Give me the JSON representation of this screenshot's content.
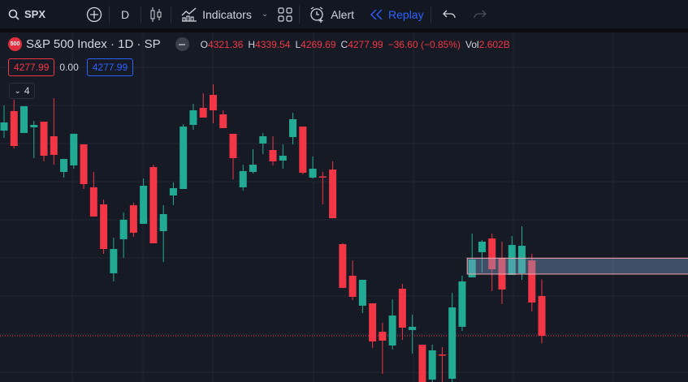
{
  "toolbar": {
    "symbol": "SPX",
    "interval": "D",
    "indicators_label": "Indicators",
    "alert_label": "Alert",
    "replay_label": "Replay"
  },
  "legend": {
    "logo_text": "500",
    "title": "S&P 500 Index · 1D · SP",
    "o_label": "O",
    "o": "4321.36",
    "h_label": "H",
    "h": "4339.54",
    "l_label": "L",
    "l": "4269.69",
    "c_label": "C",
    "c": "4277.99",
    "change": "−36.60 (−0.85%)",
    "vol_label": "Vol",
    "vol": "2.602B"
  },
  "price_boxes": {
    "bid": "4277.99",
    "spread": "0.00",
    "ask": "4277.99"
  },
  "collapse": {
    "count": "4"
  },
  "colors": {
    "up": "#22ab94",
    "down": "#f23645",
    "accent": "#2962ff"
  },
  "chart_data": {
    "type": "candlestick",
    "last_price": 4277.99,
    "candles": [
      [
        4501.9,
        4529.4,
        4493.9,
        4510.8
      ],
      [
        4523.2,
        4535.5,
        4482.4,
        4485.1
      ],
      [
        4499.3,
        4528.5,
        4499.3,
        4528.5
      ],
      [
        4505.5,
        4512.5,
        4471.8,
        4508.1
      ],
      [
        4511.6,
        4511.6,
        4468.3,
        4474.5
      ],
      [
        4495.7,
        4537.3,
        4464.7,
        4475.4
      ],
      [
        4456.8,
        4470.9,
        4450.6,
        4470.9
      ],
      [
        4463.9,
        4498.4,
        4460.3,
        4498.4
      ],
      [
        4486.9,
        4486.9,
        4438.2,
        4443.5
      ],
      [
        4440.0,
        4456.8,
        4408.1,
        4408.1
      ],
      [
        4421.4,
        4426.7,
        4367.4,
        4372.7
      ],
      [
        4346.2,
        4385.1,
        4337.3,
        4372.7
      ],
      [
        4383.3,
        4412.5,
        4363.0,
        4404.6
      ],
      [
        4420.5,
        4423.2,
        4386.0,
        4390.4
      ],
      [
        4400.1,
        4449.7,
        4400.1,
        4441.7
      ],
      [
        4462.1,
        4464.7,
        4378.9,
        4378.9
      ],
      [
        4392.2,
        4420.5,
        4358.5,
        4410.8
      ],
      [
        4431.1,
        4445.3,
        4420.5,
        4439.1
      ],
      [
        4438.2,
        4509.0,
        4438.2,
        4506.3
      ],
      [
        4508.1,
        4531.1,
        4502.8,
        4524.0
      ],
      [
        4526.7,
        4542.6,
        4516.1,
        4516.1
      ],
      [
        4540.9,
        4552.4,
        4509.9,
        4524.0
      ],
      [
        4519.6,
        4524.0,
        4504.6,
        4504.6
      ],
      [
        4498.4,
        4498.4,
        4448.8,
        4471.8
      ],
      [
        4440.0,
        4464.7,
        4436.4,
        4457.7
      ],
      [
        4456.8,
        4481.6,
        4455.0,
        4464.7
      ],
      [
        4487.8,
        4499.3,
        4476.2,
        4495.7
      ],
      [
        4480.7,
        4495.7,
        4463.9,
        4468.3
      ],
      [
        4469.2,
        4486.9,
        4460.3,
        4474.5
      ],
      [
        4494.8,
        4521.4,
        4486.9,
        4514.3
      ],
      [
        4506.3,
        4506.3,
        4454.1,
        4455.9
      ],
      [
        4450.6,
        4473.6,
        4449.7,
        4460.3
      ],
      [
        4451.9,
        4456.8,
        4421.4,
        4451.5
      ],
      [
        4459.4,
        4468.3,
        4406.3,
        4406.3
      ],
      [
        4378.0,
        4378.9,
        4330.2,
        4330.2
      ],
      [
        4343.5,
        4360.3,
        4316.9,
        4320.5
      ],
      [
        4310.8,
        4339.1,
        4302.8,
        4339.1
      ],
      [
        4313.4,
        4313.4,
        4264.7,
        4271.8
      ],
      [
        4282.4,
        4292.2,
        4236.4,
        4272.7
      ],
      [
        4267.4,
        4317.8,
        4263.0,
        4300.1
      ],
      [
        4329.3,
        4334.7,
        4273.6,
        4286.9
      ],
      [
        4284.2,
        4301.0,
        4258.5,
        4287.8
      ],
      [
        4268.3,
        4268.3,
        4219.6,
        4219.6
      ],
      [
        4230.2,
        4268.3,
        4219.6,
        4262.1
      ],
      [
        4257.6,
        4265.6,
        4219.6,
        4256.8
      ],
      [
        4231.1,
        4324.9,
        4219.6,
        4309.0
      ],
      [
        4287.8,
        4343.5,
        4283.3,
        4337.3
      ],
      [
        4341.7,
        4389.5,
        4341.7,
        4361.2
      ],
      [
        4369.2,
        4382.4,
        4347.0,
        4380.7
      ],
      [
        4384.2,
        4389.5,
        4326.7,
        4350.6
      ],
      [
        4363.0,
        4380.7,
        4312.5,
        4328.5
      ],
      [
        4344.4,
        4386.9,
        4344.4,
        4377.1
      ],
      [
        4346.2,
        4397.5,
        4339.1,
        4376.2
      ],
      [
        4360.3,
        4367.4,
        4304.6,
        4314.3
      ],
      [
        4321.36,
        4339.54,
        4269.69,
        4277.99
      ]
    ],
    "zone": {
      "from_candle": 47,
      "price_top": 4362.7,
      "price_bottom": 4345.3
    }
  }
}
